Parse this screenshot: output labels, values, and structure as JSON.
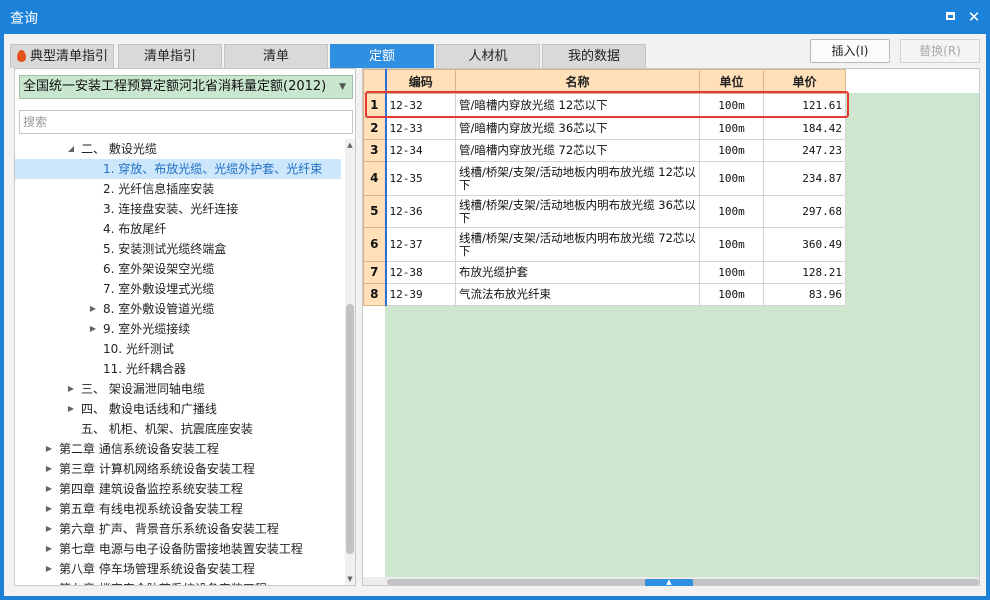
{
  "window": {
    "title": "查询",
    "maximize_icon": "maximize-icon",
    "close_icon": "close-icon",
    "close_glyph": "✕"
  },
  "tabs": [
    {
      "label": "典型清单指引",
      "icon": "flame-icon",
      "active": false
    },
    {
      "label": "清单指引",
      "active": false
    },
    {
      "label": "清单",
      "active": false
    },
    {
      "label": "定额",
      "active": true
    },
    {
      "label": "人材机",
      "active": false
    },
    {
      "label": "我的数据",
      "active": false
    }
  ],
  "actions": {
    "insert": "插入(I)",
    "replace": "替换(R)"
  },
  "left": {
    "quota_library": "全国统一安装工程预算定额河北省消耗量定额(2012)",
    "search_placeholder": "搜索",
    "tree": [
      {
        "label": "二、 敷设光缆",
        "arrow": "◢",
        "level": 2,
        "selected": false
      },
      {
        "label": "1. 穿放、布放光缆、光缆外护套、光纤束",
        "arrow": "",
        "level": 3,
        "selected": true
      },
      {
        "label": "2. 光纤信息插座安装",
        "arrow": "",
        "level": 3,
        "selected": false
      },
      {
        "label": "3. 连接盘安装、光纤连接",
        "arrow": "",
        "level": 3,
        "selected": false
      },
      {
        "label": "4. 布放尾纤",
        "arrow": "",
        "level": 3,
        "selected": false
      },
      {
        "label": "5. 安装测试光缆终端盒",
        "arrow": "",
        "level": 3,
        "selected": false
      },
      {
        "label": "6. 室外架设架空光缆",
        "arrow": "",
        "level": 3,
        "selected": false
      },
      {
        "label": "7. 室外敷设埋式光缆",
        "arrow": "",
        "level": 3,
        "selected": false
      },
      {
        "label": "8. 室外敷设管道光缆",
        "arrow": "▶",
        "level": 3,
        "selected": false
      },
      {
        "label": "9. 室外光缆接续",
        "arrow": "▶",
        "level": 3,
        "selected": false
      },
      {
        "label": "10. 光纤测试",
        "arrow": "",
        "level": 3,
        "selected": false
      },
      {
        "label": "11. 光纤耦合器",
        "arrow": "",
        "level": 3,
        "selected": false
      },
      {
        "label": "三、 架设漏泄同轴电缆",
        "arrow": "▶",
        "level": 2,
        "selected": false
      },
      {
        "label": "四、 敷设电话线和广播线",
        "arrow": "▶",
        "level": 2,
        "selected": false
      },
      {
        "label": "五、 机柜、机架、抗震底座安装",
        "arrow": "",
        "level": 2,
        "selected": false
      },
      {
        "label": "第二章 通信系统设备安装工程",
        "arrow": "▶",
        "level": 1,
        "selected": false
      },
      {
        "label": "第三章 计算机网络系统设备安装工程",
        "arrow": "▶",
        "level": 1,
        "selected": false
      },
      {
        "label": "第四章 建筑设备监控系统安装工程",
        "arrow": "▶",
        "level": 1,
        "selected": false
      },
      {
        "label": "第五章 有线电视系统设备安装工程",
        "arrow": "▶",
        "level": 1,
        "selected": false
      },
      {
        "label": "第六章 扩声、背景音乐系统设备安装工程",
        "arrow": "▶",
        "level": 1,
        "selected": false
      },
      {
        "label": "第七章 电源与电子设备防雷接地装置安装工程",
        "arrow": "▶",
        "level": 1,
        "selected": false
      },
      {
        "label": "第八章 停车场管理系统设备安装工程",
        "arrow": "▶",
        "level": 1,
        "selected": false
      },
      {
        "label": "第九章 楼宇安全防范系统设备安装工程",
        "arrow": "▶",
        "level": 1,
        "selected": false
      }
    ]
  },
  "grid": {
    "columns": {
      "code": "编码",
      "name": "名称",
      "unit": "单位",
      "price": "单价"
    },
    "rows": [
      {
        "n": "1",
        "code": "12-32",
        "name": "管/暗槽内穿放光缆 12芯以下",
        "unit": "100m",
        "price": "121.61",
        "h": 24
      },
      {
        "n": "2",
        "code": "12-33",
        "name": "管/暗槽内穿放光缆 36芯以下",
        "unit": "100m",
        "price": "184.42",
        "h": 22
      },
      {
        "n": "3",
        "code": "12-34",
        "name": "管/暗槽内穿放光缆 72芯以下",
        "unit": "100m",
        "price": "247.23",
        "h": 22
      },
      {
        "n": "4",
        "code": "12-35",
        "name": "线槽/桥架/支架/活动地板内明布放光缆 12芯以下",
        "unit": "100m",
        "price": "234.87",
        "h": 34
      },
      {
        "n": "5",
        "code": "12-36",
        "name": "线槽/桥架/支架/活动地板内明布放光缆 36芯以下",
        "unit": "100m",
        "price": "297.68",
        "h": 32
      },
      {
        "n": "6",
        "code": "12-37",
        "name": "线槽/桥架/支架/活动地板内明布放光缆 72芯以下",
        "unit": "100m",
        "price": "360.49",
        "h": 34
      },
      {
        "n": "7",
        "code": "12-38",
        "name": "布放光缆护套",
        "unit": "100m",
        "price": "128.21",
        "h": 22
      },
      {
        "n": "8",
        "code": "12-39",
        "name": "气流法布放光纤束",
        "unit": "100m",
        "price": "83.96",
        "h": 22
      }
    ]
  },
  "colors": {
    "titlebar": "#1c81d9",
    "tab_active": "#2f8fe0",
    "highlight": "#e53935",
    "grid_header": "#ffe0b8",
    "empty_area": "#cde6cd"
  }
}
